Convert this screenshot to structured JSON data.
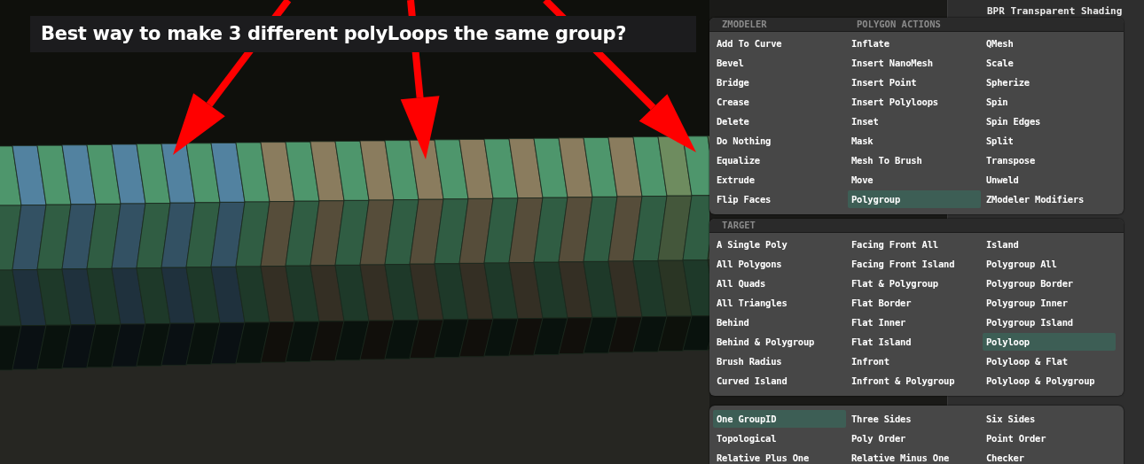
{
  "viewport": {
    "caption": "Best way to make 3 different polyLoops the same group?"
  },
  "sidebar": {
    "title": "BPR Transparent Shading"
  },
  "menus": [
    {
      "headers": [
        "ZMODELER",
        "POLYGON ACTIONS"
      ],
      "columns": [
        [
          {
            "label": "Add To Curve",
            "selected": false
          },
          {
            "label": "Bevel",
            "selected": false
          },
          {
            "label": "Bridge",
            "selected": false
          },
          {
            "label": "Crease",
            "selected": false
          },
          {
            "label": "Delete",
            "selected": false
          },
          {
            "label": "Do Nothing",
            "selected": false
          },
          {
            "label": "Equalize",
            "selected": false
          },
          {
            "label": "Extrude",
            "selected": false
          },
          {
            "label": "Flip Faces",
            "selected": false
          }
        ],
        [
          {
            "label": "Inflate",
            "selected": false
          },
          {
            "label": "Insert NanoMesh",
            "selected": false
          },
          {
            "label": "Insert Point",
            "selected": false
          },
          {
            "label": "Insert Polyloops",
            "selected": false
          },
          {
            "label": "Inset",
            "selected": false
          },
          {
            "label": "Mask",
            "selected": false
          },
          {
            "label": "Mesh To Brush",
            "selected": false
          },
          {
            "label": "Move",
            "selected": false
          },
          {
            "label": "Polygroup",
            "selected": true
          }
        ],
        [
          {
            "label": "QMesh",
            "selected": false
          },
          {
            "label": "Scale",
            "selected": false
          },
          {
            "label": "Spherize",
            "selected": false
          },
          {
            "label": "Spin",
            "selected": false
          },
          {
            "label": "Spin Edges",
            "selected": false
          },
          {
            "label": "Split",
            "selected": false
          },
          {
            "label": "Transpose",
            "selected": false
          },
          {
            "label": "Unweld",
            "selected": false
          },
          {
            "label": "ZModeler Modifiers",
            "selected": false
          }
        ]
      ]
    },
    {
      "headers": [
        "TARGET"
      ],
      "columns": [
        [
          {
            "label": "A Single Poly",
            "selected": false
          },
          {
            "label": "All Polygons",
            "selected": false
          },
          {
            "label": "All Quads",
            "selected": false
          },
          {
            "label": "All Triangles",
            "selected": false
          },
          {
            "label": "Behind",
            "selected": false
          },
          {
            "label": "Behind & Polygroup",
            "selected": false
          },
          {
            "label": "Brush Radius",
            "selected": false
          },
          {
            "label": "Curved Island",
            "selected": false
          }
        ],
        [
          {
            "label": "Facing Front All",
            "selected": false
          },
          {
            "label": "Facing Front Island",
            "selected": false
          },
          {
            "label": "Flat & Polygroup",
            "selected": false
          },
          {
            "label": "Flat Border",
            "selected": false
          },
          {
            "label": "Flat Inner",
            "selected": false
          },
          {
            "label": "Flat Island",
            "selected": false
          },
          {
            "label": "Infront",
            "selected": false
          },
          {
            "label": "Infront & Polygroup",
            "selected": false
          }
        ],
        [
          {
            "label": "Island",
            "selected": false
          },
          {
            "label": "Polygroup All",
            "selected": false
          },
          {
            "label": "Polygroup Border",
            "selected": false
          },
          {
            "label": "Polygroup Inner",
            "selected": false
          },
          {
            "label": "Polygroup Island",
            "selected": false
          },
          {
            "label": "Polyloop",
            "selected": true
          },
          {
            "label": "Polyloop & Flat",
            "selected": false
          },
          {
            "label": "Polyloop & Polygroup",
            "selected": false
          }
        ]
      ]
    },
    {
      "columns": [
        [
          {
            "label": "One GroupID",
            "selected": true
          },
          {
            "label": "Topological",
            "selected": false
          },
          {
            "label": "Relative Plus One",
            "selected": false
          }
        ],
        [
          {
            "label": "Three Sides",
            "selected": false
          },
          {
            "label": "Poly Order",
            "selected": false
          },
          {
            "label": "Relative Minus One",
            "selected": false
          }
        ],
        [
          {
            "label": "Six Sides",
            "selected": false
          },
          {
            "label": "Point Order",
            "selected": false
          },
          {
            "label": "Checker",
            "selected": false
          }
        ]
      ]
    }
  ]
}
